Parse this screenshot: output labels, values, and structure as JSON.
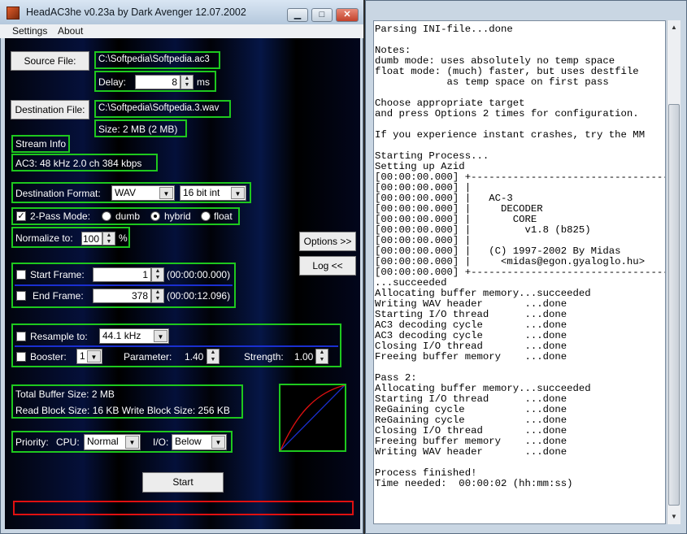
{
  "window": {
    "title": "HeadAC3he v0.23a by Dark Avenger 12.07.2002",
    "min_glyph": "▁",
    "max_glyph": "□",
    "close_glyph": "✕",
    "icon": "app-icon"
  },
  "menu": {
    "items": [
      "Settings",
      "About"
    ]
  },
  "source": {
    "button_label": "Source File:",
    "path": "C:\\Softpedia\\Softpedia.ac3",
    "delay_label": "Delay:",
    "delay_value": "8",
    "delay_unit": "ms"
  },
  "destination": {
    "button_label": "Destination File:",
    "path": "C:\\Softpedia\\Softpedia.3.wav",
    "size_text": "Size:   2 MB  (2 MB)"
  },
  "stream": {
    "label": "Stream Info",
    "info": "AC3:  48 kHz   2.0 ch   384 kbps"
  },
  "format": {
    "label": "Destination Format:",
    "value": "WAV",
    "bits": "16 bit int"
  },
  "two_pass": {
    "label": "2-Pass Mode:",
    "checked": true,
    "options": [
      "dumb",
      "hybrid",
      "float"
    ],
    "selected": "hybrid"
  },
  "normalize": {
    "label": "Normalize to:",
    "value": "100",
    "unit": "%"
  },
  "side_buttons": {
    "options": "Options >>",
    "log": "Log <<"
  },
  "frames": {
    "start_label": "Start Frame:",
    "start_value": "1",
    "start_time": "(00:00:00.000)",
    "end_label": "End Frame:",
    "end_value": "378",
    "end_time": "(00:00:12.096)"
  },
  "resample": {
    "label": "Resample to:",
    "value": "44.1 kHz"
  },
  "booster": {
    "label": "Booster:",
    "value": "1",
    "param_label": "Parameter:",
    "param_value": "1.40",
    "strength_label": "Strength:",
    "strength_value": "1.00"
  },
  "buffer": {
    "total": "Total Buffer Size:    2 MB",
    "rw": "Read Block Size:  16 KB   Write Block Size:   256 KB"
  },
  "priority": {
    "label": "Priority:",
    "cpu_label": "CPU:",
    "cpu_value": "Normal",
    "io_label": "I/O:",
    "io_value": "Below"
  },
  "start_button": "Start",
  "progress": 0,
  "colors": {
    "group_border": "#1ec81e",
    "progress_border": "#e01010",
    "curve_red": "#e01010",
    "curve_blue": "#1a2fd0"
  },
  "scroll": {
    "up": "▲",
    "down": "▼"
  },
  "log_lines": [
    "Parsing INI-file...done",
    "",
    "Notes:",
    "dumb mode: uses absolutely no temp space",
    "float mode: (much) faster, but uses destfile",
    "            as temp space on first pass",
    "",
    "Choose appropriate target",
    "and press Options 2 times for configuration.",
    "",
    "If you experience instant crashes, try the MM",
    "",
    "Starting Process...",
    "Setting up Azid",
    "[00:00:00.000] +---------------------------------",
    "[00:00:00.000] |",
    "[00:00:00.000] |   AC-3",
    "[00:00:00.000] |     DECODER",
    "[00:00:00.000] |       CORE",
    "[00:00:00.000] |         v1.8 (b825)",
    "[00:00:00.000] |",
    "[00:00:00.000] |   (C) 1997-2002 By Midas",
    "[00:00:00.000] |     <midas@egon.gyaloglo.hu>",
    "[00:00:00.000] +---------------------------------",
    "...succeeded",
    "Allocating buffer memory...succeeded",
    "Writing WAV header       ...done",
    "Starting I/O thread      ...done",
    "AC3 decoding cycle       ...done",
    "AC3 decoding cycle       ...done",
    "Closing I/O thread       ...done",
    "Freeing buffer memory    ...done",
    "",
    "Pass 2:",
    "Allocating buffer memory...succeeded",
    "Starting I/O thread      ...done",
    "ReGaining cycle          ...done",
    "ReGaining cycle          ...done",
    "Closing I/O thread       ...done",
    "Freeing buffer memory    ...done",
    "Writing WAV header       ...done",
    "",
    "Process finished!",
    "Time needed:  00:00:02 (hh:mm:ss)"
  ]
}
